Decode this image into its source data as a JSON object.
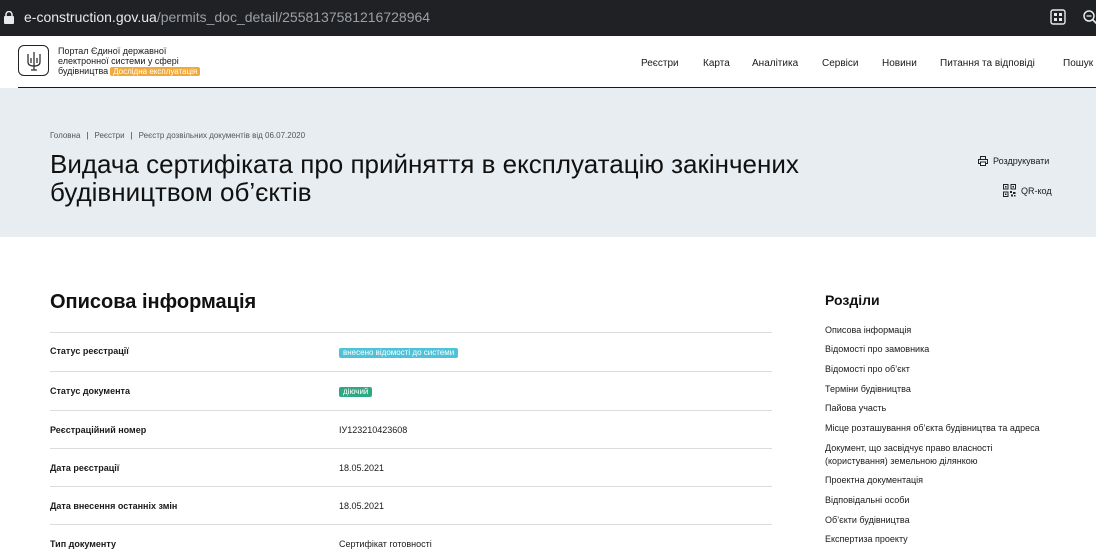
{
  "browser": {
    "url_domain": "e-construction.gov.ua",
    "url_path": "/permits_doc_detail/2558137581216728964"
  },
  "header": {
    "portal_line1": "Портал Єдиної державної",
    "portal_line2": "електронної системи у сфері",
    "portal_line3": "будівництва",
    "beta_label": "Дослідна експлуатація",
    "nav": [
      "Реєстри",
      "Карта",
      "Аналітика",
      "Сервіси",
      "Новини",
      "Питання та відповіді",
      "Пошук"
    ]
  },
  "breadcrumb": [
    "Головна",
    "Реєстри",
    "Реєстр дозвільних документів від 06.07.2020"
  ],
  "page_title": "Видача сертифіката про прийняття в експлуатацію закінчених будівництвом об’єктів",
  "actions": {
    "print_label": "Роздрукувати",
    "qr_label": "QR-код"
  },
  "section": {
    "title": "Описова інформація",
    "rows": [
      {
        "label": "Статус реєстрації",
        "value": "внесено відомості до системи",
        "badge": true,
        "badge_color": "#4ec3d8"
      },
      {
        "label": "Статус документа",
        "value": "діючий",
        "badge": true,
        "badge_color": "#2fa984"
      },
      {
        "label": "Реєстраційний номер",
        "value": "ІУ123210423608",
        "badge": false
      },
      {
        "label": "Дата реєстрації",
        "value": "18.05.2021",
        "badge": false
      },
      {
        "label": "Дата внесення останніх змін",
        "value": "18.05.2021",
        "badge": false
      },
      {
        "label": "Тип документу",
        "value": "Сертифікат готовності",
        "badge": false
      }
    ]
  },
  "sidebar": {
    "title": "Розділи",
    "items": [
      "Описова інформація",
      "Відомості про замовника",
      "Відомості про об’єкт",
      "Терміни будівництва",
      "Пайова участь",
      "Місце розташування об’єкта будівництва та адреса",
      "Документ, що засвідчує право власності (користування) земельною ділянкою",
      "Проектна документація",
      "Відповідальні особи",
      "Об’єкти будівництва",
      "Експертиза проекту"
    ]
  }
}
